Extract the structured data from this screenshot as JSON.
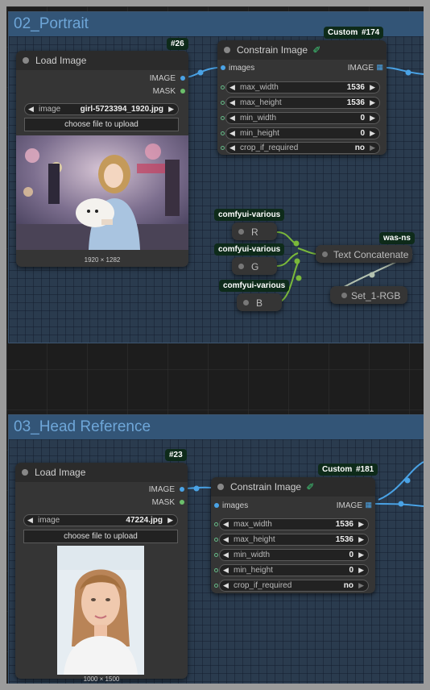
{
  "groups": [
    {
      "title": "02_Portrait"
    },
    {
      "title": "03_Head Reference"
    }
  ],
  "load_image_1": {
    "badge": "#26",
    "title": "Load Image",
    "out_image": "IMAGE",
    "out_mask": "MASK",
    "image_label": "image",
    "image_value": "girl-5723394_1920.jpg",
    "upload_button": "choose file to upload",
    "caption": "1920 × 1282"
  },
  "constrain_1": {
    "badge_custom": "Custom-S",
    "badge_id": "#174",
    "title": "Constrain Image",
    "in_images": "images",
    "out_image": "IMAGE",
    "widgets": [
      {
        "label": "max_width",
        "value": "1536"
      },
      {
        "label": "max_height",
        "value": "1536"
      },
      {
        "label": "min_width",
        "value": "0"
      },
      {
        "label": "min_height",
        "value": "0"
      },
      {
        "label": "crop_if_required",
        "value": "no"
      }
    ]
  },
  "various": {
    "badge_r": "comfyui-various",
    "r_label": "R",
    "badge_g": "comfyui-various",
    "g_label": "G",
    "badge_b": "comfyui-various",
    "b_label": "B"
  },
  "text_concat": {
    "badge": "was-ns",
    "title": "Text Concatenate"
  },
  "set_node": {
    "title": "Set_1-RGB"
  },
  "load_image_2": {
    "badge": "#23",
    "title": "Load Image",
    "out_image": "IMAGE",
    "out_mask": "MASK",
    "image_label": "image",
    "image_value": "47224.jpg",
    "upload_button": "choose file to upload",
    "caption": "1000 × 1500"
  },
  "constrain_2": {
    "badge_custom": "Custom-S",
    "badge_id": "#181",
    "title": "Constrain Image",
    "in_images": "images",
    "out_image": "IMAGE",
    "widgets": [
      {
        "label": "max_width",
        "value": "1536"
      },
      {
        "label": "max_height",
        "value": "1536"
      },
      {
        "label": "min_width",
        "value": "0"
      },
      {
        "label": "min_height",
        "value": "0"
      },
      {
        "label": "crop_if_required",
        "value": "no"
      }
    ]
  },
  "colors": {
    "link_image": "#4aa3e6",
    "link_string": "#7ab83a",
    "group_title": "#6ea6d8",
    "badge_bg": "#0e2b1a"
  }
}
